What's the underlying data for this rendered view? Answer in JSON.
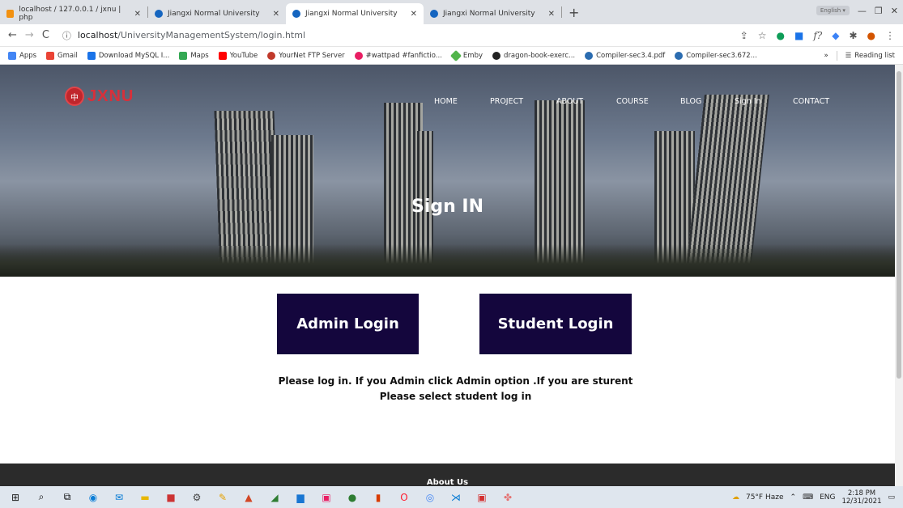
{
  "browser": {
    "tabs": [
      {
        "label": "localhost / 127.0.0.1 / jxnu | php",
        "active": false
      },
      {
        "label": "Jiangxi Normal University",
        "active": false
      },
      {
        "label": "Jiangxi Normal University",
        "active": true
      },
      {
        "label": "Jiangxi Normal University",
        "active": false
      }
    ],
    "new_tab": "+",
    "url_host": "localhost",
    "url_path": "/UniversityManagementSystem/login.html",
    "bookmarks": [
      {
        "label": "Apps",
        "color": "#4285f4"
      },
      {
        "label": "Gmail",
        "color": "#ea4335"
      },
      {
        "label": "Download MySQL I...",
        "color": "#1a73e8"
      },
      {
        "label": "Maps",
        "color": "#34a853"
      },
      {
        "label": "YouTube",
        "color": "#ff0000"
      },
      {
        "label": "YourNet FTP Server",
        "color": "#c0392b"
      },
      {
        "label": "#wattpad #fanfictio...",
        "color": "#e91e63"
      },
      {
        "label": "Emby",
        "color": "#52b54b"
      },
      {
        "label": "dragon-book-exerc...",
        "color": "#222222"
      },
      {
        "label": "Compiler-sec3.4.pdf",
        "color": "#2b6cb0"
      },
      {
        "label": "Compiler-sec3.672...",
        "color": "#2b6cb0"
      }
    ],
    "bookmarks_more": "»",
    "reading_list": "Reading list"
  },
  "site": {
    "logo_name": "JXNU",
    "nav": [
      "HOME",
      "PROJECT",
      "ABOUT",
      "COURSE",
      "BLOG",
      "Sign In",
      "CONTACT"
    ],
    "hero_title": "Sign IN",
    "admin_button": "Admin Login",
    "student_button": "Student Login",
    "message_line1": "Please log in. If you Admin click Admin option .If you are sturent",
    "message_line2": "Please select student log in",
    "footer_title": "About Us",
    "colors": {
      "button_bg": "#14063d",
      "logo_red": "#d8303a",
      "footer_bg": "#2b2b2b"
    }
  },
  "taskbar": {
    "weather": "75°F Haze",
    "lang": "ENG",
    "time": "2:18 PM",
    "date": "12/31/2021"
  }
}
